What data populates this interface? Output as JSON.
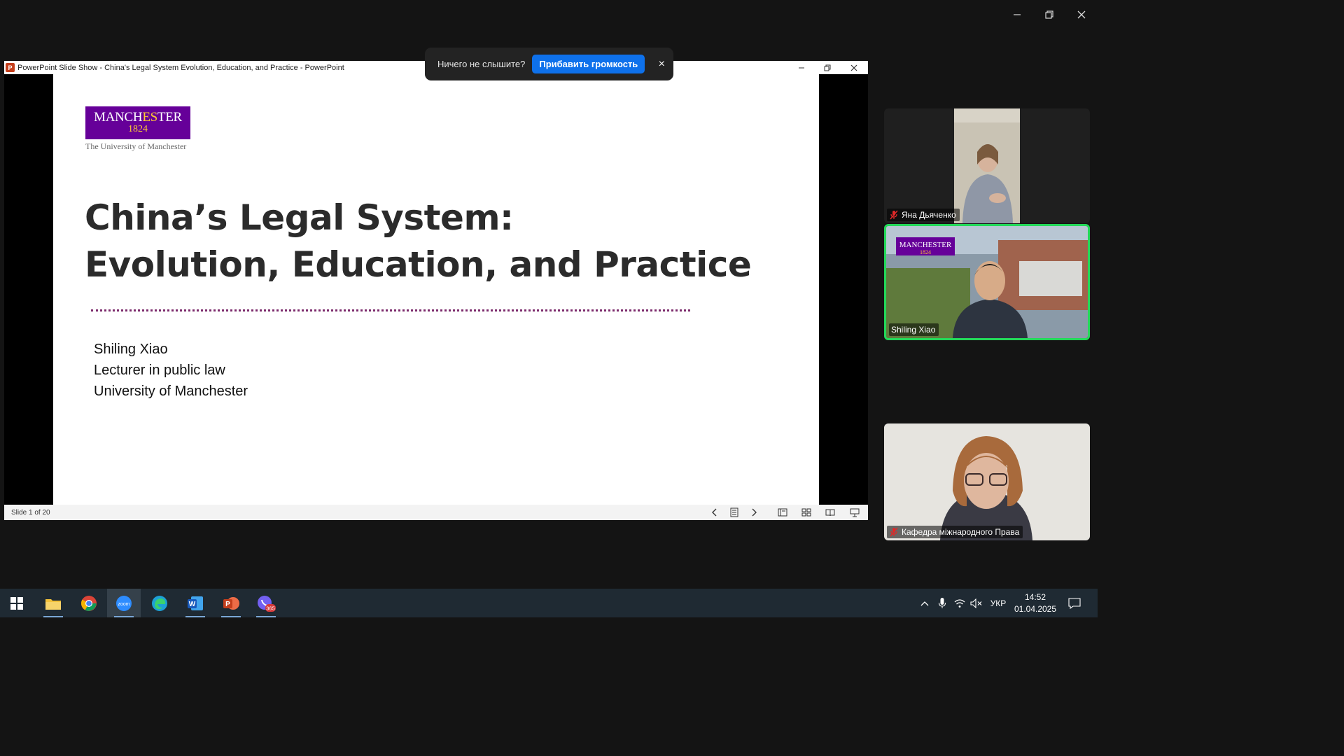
{
  "zoom_window": {
    "minimize_label": "minimize",
    "restore_label": "restore",
    "close_label": "close"
  },
  "ppt": {
    "window_title": "PowerPoint Slide Show  -  China's Legal System Evolution, Education, and Practice - PowerPoint",
    "app_icon_letter": "P",
    "slide_counter": "Slide 1 of 20",
    "slide": {
      "logo_name_a": "MANCH",
      "logo_name_b": "ES",
      "logo_name_c": "TER",
      "logo_year": "1824",
      "logo_subtitle": "The University of Manchester",
      "title_line1": "China’s Legal System:",
      "title_line2": "Evolution, Education, and Practice",
      "author_name": "Shiling Xiao",
      "author_role": "Lecturer in public law",
      "author_affiliation": "University of Manchester"
    }
  },
  "toast": {
    "message": "Ничего не слышите?",
    "button_label": "Прибавить громкость",
    "close_glyph": "×"
  },
  "participants": [
    {
      "name": "Яна Дьяченко",
      "muted": true
    },
    {
      "name": "Shiling Xiao",
      "muted": false,
      "active_speaker": true
    },
    {
      "name": "Кафедра міжнародного Права",
      "muted": true
    }
  ],
  "taskbar": {
    "viber_badge": "365",
    "language": "УКР",
    "time": "14:52",
    "date": "01.04.2025"
  },
  "colors": {
    "active_speaker_border": "#23d959",
    "toast_button": "#0e71eb",
    "uom_purple": "#660099",
    "uom_gold": "#ffcc33"
  }
}
